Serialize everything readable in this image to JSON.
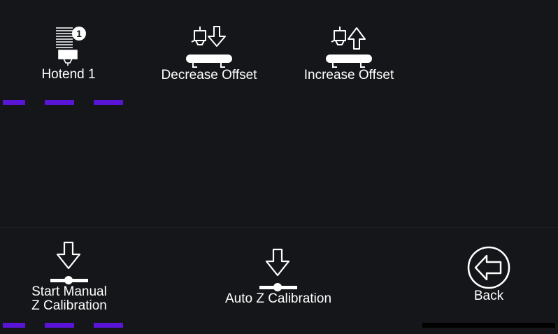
{
  "colors": {
    "background": "#141619",
    "accent": "#5a14d8",
    "text": "#ffffff"
  },
  "top_row": {
    "hotend": {
      "label": "Hotend 1",
      "badge": "1",
      "icon": "hotend-icon"
    },
    "decrease": {
      "label": "Decrease Offset",
      "icon": "nozzle-down-arrow-icon"
    },
    "increase": {
      "label": "Increase Offset",
      "icon": "nozzle-up-arrow-icon"
    }
  },
  "bottom_row": {
    "manual_z": {
      "label_line1": "Start Manual",
      "label_line2": "Z Calibration",
      "icon": "z-calibrate-icon"
    },
    "auto_z": {
      "label": "Auto Z Calibration",
      "icon": "z-calibrate-icon"
    },
    "back": {
      "label": "Back",
      "icon": "back-arrow-circle-icon"
    }
  }
}
